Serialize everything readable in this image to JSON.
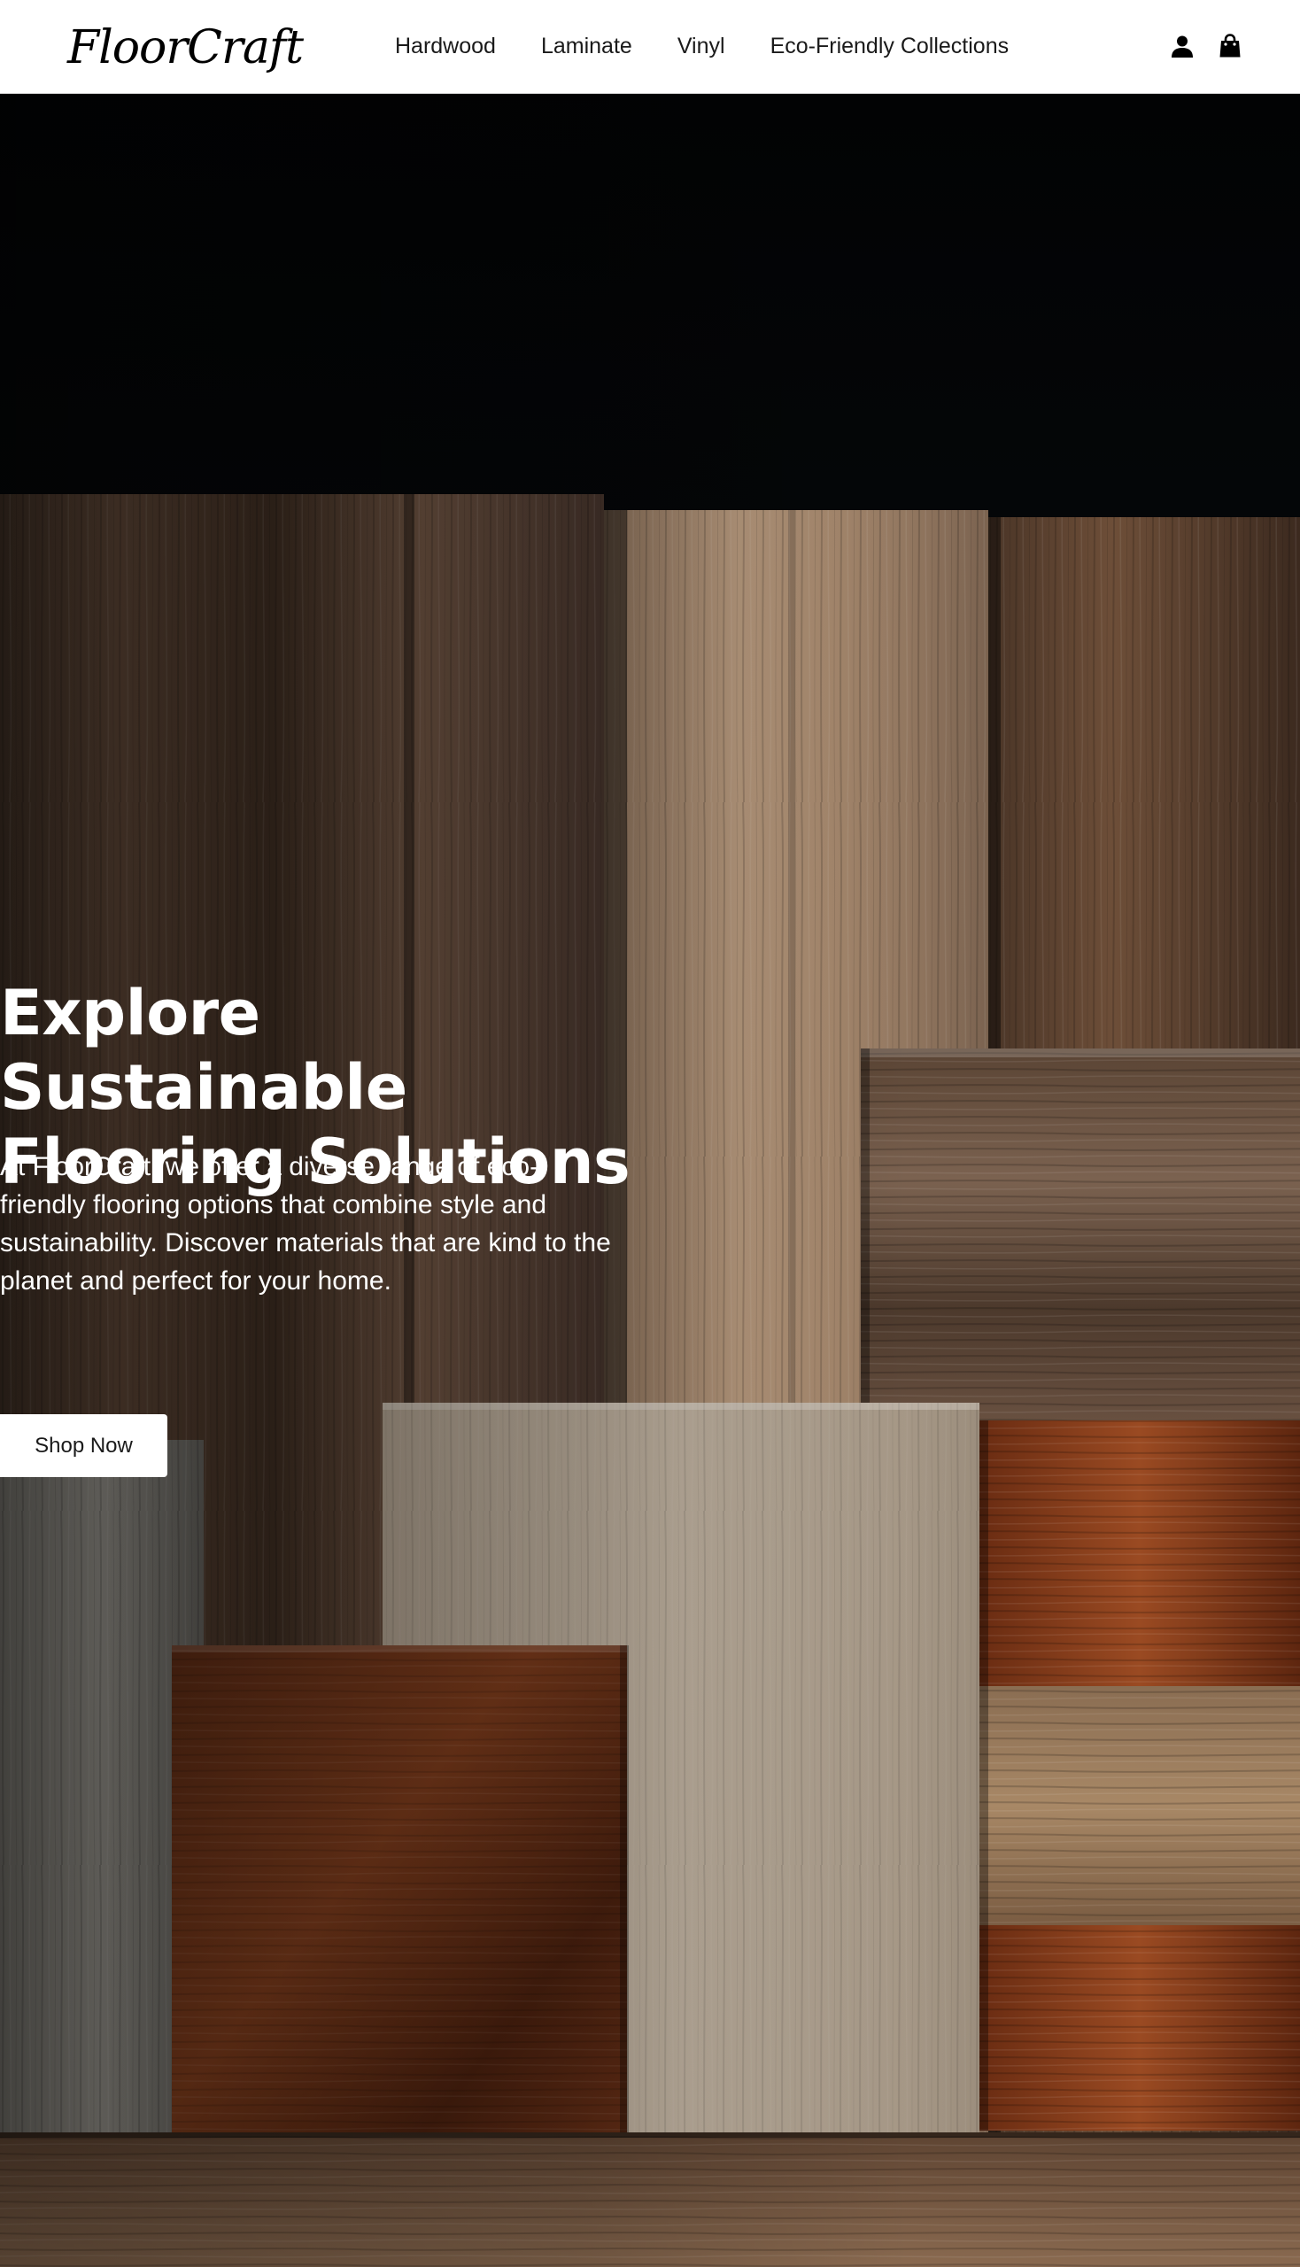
{
  "header": {
    "logo": "FloorCraft",
    "nav": [
      {
        "label": "Hardwood"
      },
      {
        "label": "Laminate"
      },
      {
        "label": "Vinyl"
      },
      {
        "label": "Eco-Friendly Collections"
      }
    ],
    "icons": {
      "account": "user-icon",
      "cart": "shopping-bag-icon"
    }
  },
  "hero": {
    "title": "Explore Sustainable Flooring Solutions",
    "description": "At FloorCraft, we offer a diverse range of eco-friendly flooring options that combine style and sustainability. Discover materials that are kind to the planet and perfect for your home.",
    "button_label": "Shop Now",
    "image": "wood-flooring-samples-image"
  },
  "colors": {
    "header_bg": "#ffffff",
    "text_dark": "#1a1a1a",
    "hero_text": "#ffffff",
    "button_bg": "#ffffff"
  }
}
